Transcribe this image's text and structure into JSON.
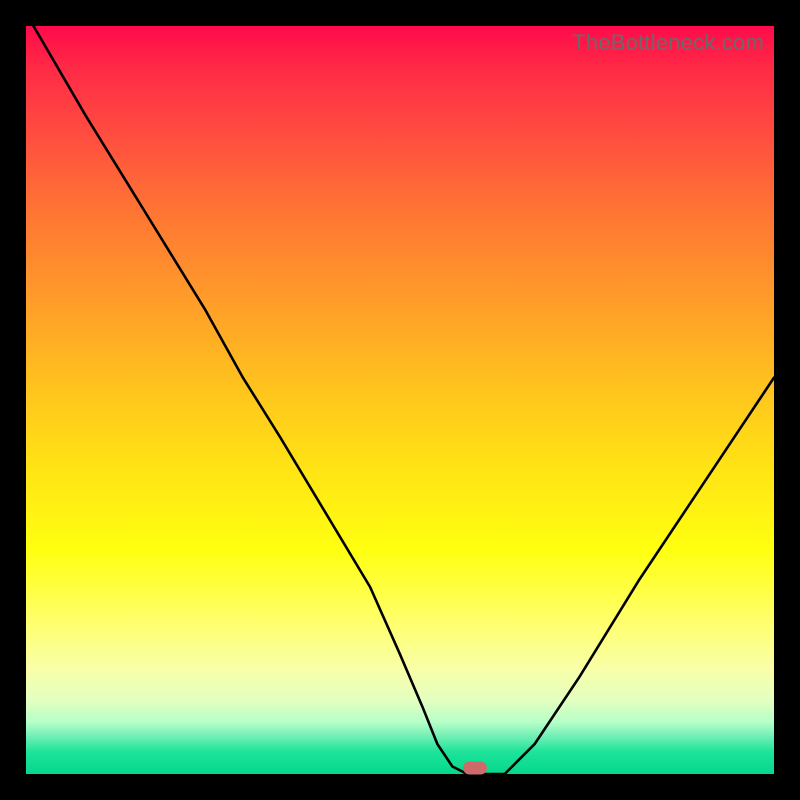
{
  "watermark": "TheBottleneck.com",
  "colors": {
    "frame": "#000000",
    "gradient_top": "#ff0a4a",
    "gradient_bottom": "#05d88b",
    "curve": "#000000",
    "marker": "#cd6a6a"
  },
  "chart_data": {
    "type": "line",
    "title": "",
    "xlabel": "",
    "ylabel": "",
    "xlim": [
      0,
      100
    ],
    "ylim": [
      0,
      100
    ],
    "grid": false,
    "legend": false,
    "x": [
      1,
      8,
      16,
      24,
      29,
      34,
      40,
      46,
      50,
      53,
      55,
      57,
      59,
      61,
      64,
      68,
      74,
      82,
      90,
      100
    ],
    "values": [
      100,
      88,
      75,
      62,
      53,
      45,
      35,
      25,
      16,
      9,
      4,
      1,
      0,
      0,
      0,
      4,
      13,
      26,
      38,
      53
    ],
    "marker": {
      "x": 60,
      "y": 0
    },
    "note": "V-shaped bottleneck curve; y=0 is optimal (green), y=100 is severe (red). Values estimated from pixels."
  }
}
